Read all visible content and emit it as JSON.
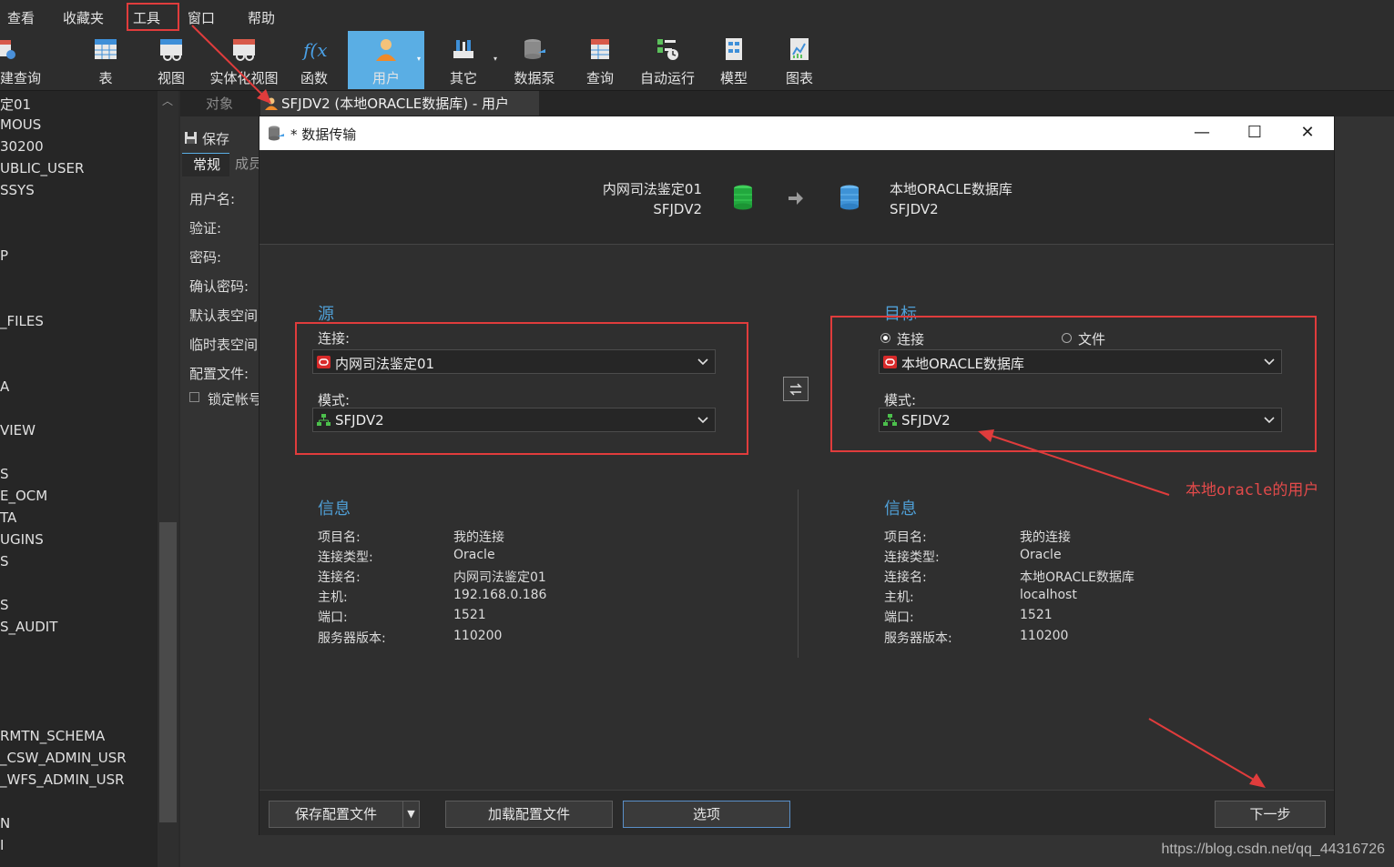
{
  "menu": [
    "查看",
    "收藏夹",
    "工具",
    "窗口",
    "帮助"
  ],
  "toolbar": {
    "left_partial": "建查询",
    "items": [
      "表",
      "视图",
      "实体化视图",
      "函数",
      "用户",
      "其它",
      "数据泵",
      "查询",
      "自动运行",
      "模型",
      "图表"
    ],
    "active": "用户"
  },
  "sidebar": {
    "items": [
      "定01",
      "MOUS",
      "30200",
      "UBLIC_USER",
      "SSYS",
      "P",
      "_FILES",
      "A",
      "VIEW",
      "S",
      "E_OCM",
      "TA",
      "UGINS",
      "S",
      "S",
      "S_AUDIT",
      "RMTN_SCHEMA",
      "_CSW_ADMIN_USR",
      "_WFS_ADMIN_USR",
      "N",
      "I"
    ]
  },
  "tabs": {
    "objects": "对象",
    "active": "SFJDV2 (本地ORACLE数据库) - 用户"
  },
  "bg_editor": {
    "save": "保存",
    "subtab_general": "常规",
    "subtab_member": "成员",
    "fields": [
      "用户名:",
      "验证:",
      "密码:",
      "确认密码:",
      "默认表空间",
      "临时表空间",
      "配置文件:",
      "锁定帐号"
    ]
  },
  "dialog": {
    "title": "* 数据传输",
    "header": {
      "src_conn": "内网司法鉴定01",
      "src_schema": "SFJDV2",
      "dst_conn": "本地ORACLE数据库",
      "dst_schema": "SFJDV2"
    },
    "source": {
      "title": "源",
      "conn_label": "连接:",
      "conn_value": "内网司法鉴定01",
      "schema_label": "模式:",
      "schema_value": "SFJDV2"
    },
    "target": {
      "title": "目标",
      "radio_conn": "连接",
      "radio_file": "文件",
      "conn_value": "本地ORACLE数据库",
      "schema_label": "模式:",
      "schema_value": "SFJDV2"
    },
    "info_left": {
      "title": "信息",
      "rows": [
        {
          "label": "项目名:",
          "value": "我的连接"
        },
        {
          "label": "连接类型:",
          "value": "Oracle"
        },
        {
          "label": "连接名:",
          "value": "内网司法鉴定01"
        },
        {
          "label": "主机:",
          "value": "192.168.0.186"
        },
        {
          "label": "端口:",
          "value": "1521"
        },
        {
          "label": "服务器版本:",
          "value": "110200"
        }
      ]
    },
    "info_right": {
      "title": "信息",
      "rows": [
        {
          "label": "项目名:",
          "value": "我的连接"
        },
        {
          "label": "连接类型:",
          "value": "Oracle"
        },
        {
          "label": "连接名:",
          "value": "本地ORACLE数据库"
        },
        {
          "label": "主机:",
          "value": "localhost"
        },
        {
          "label": "端口:",
          "value": "1521"
        },
        {
          "label": "服务器版本:",
          "value": "110200"
        }
      ]
    },
    "footer": {
      "save_profile": "保存配置文件",
      "load_profile": "加载配置文件",
      "options": "选项",
      "next": "下一步"
    }
  },
  "annotation": "本地oracle的用户",
  "watermark": "https://blog.csdn.net/qq_44316726",
  "colors": {
    "accent": "#5aaee4",
    "section_title": "#4f9fd6",
    "annotation_red": "#e03c3c"
  }
}
